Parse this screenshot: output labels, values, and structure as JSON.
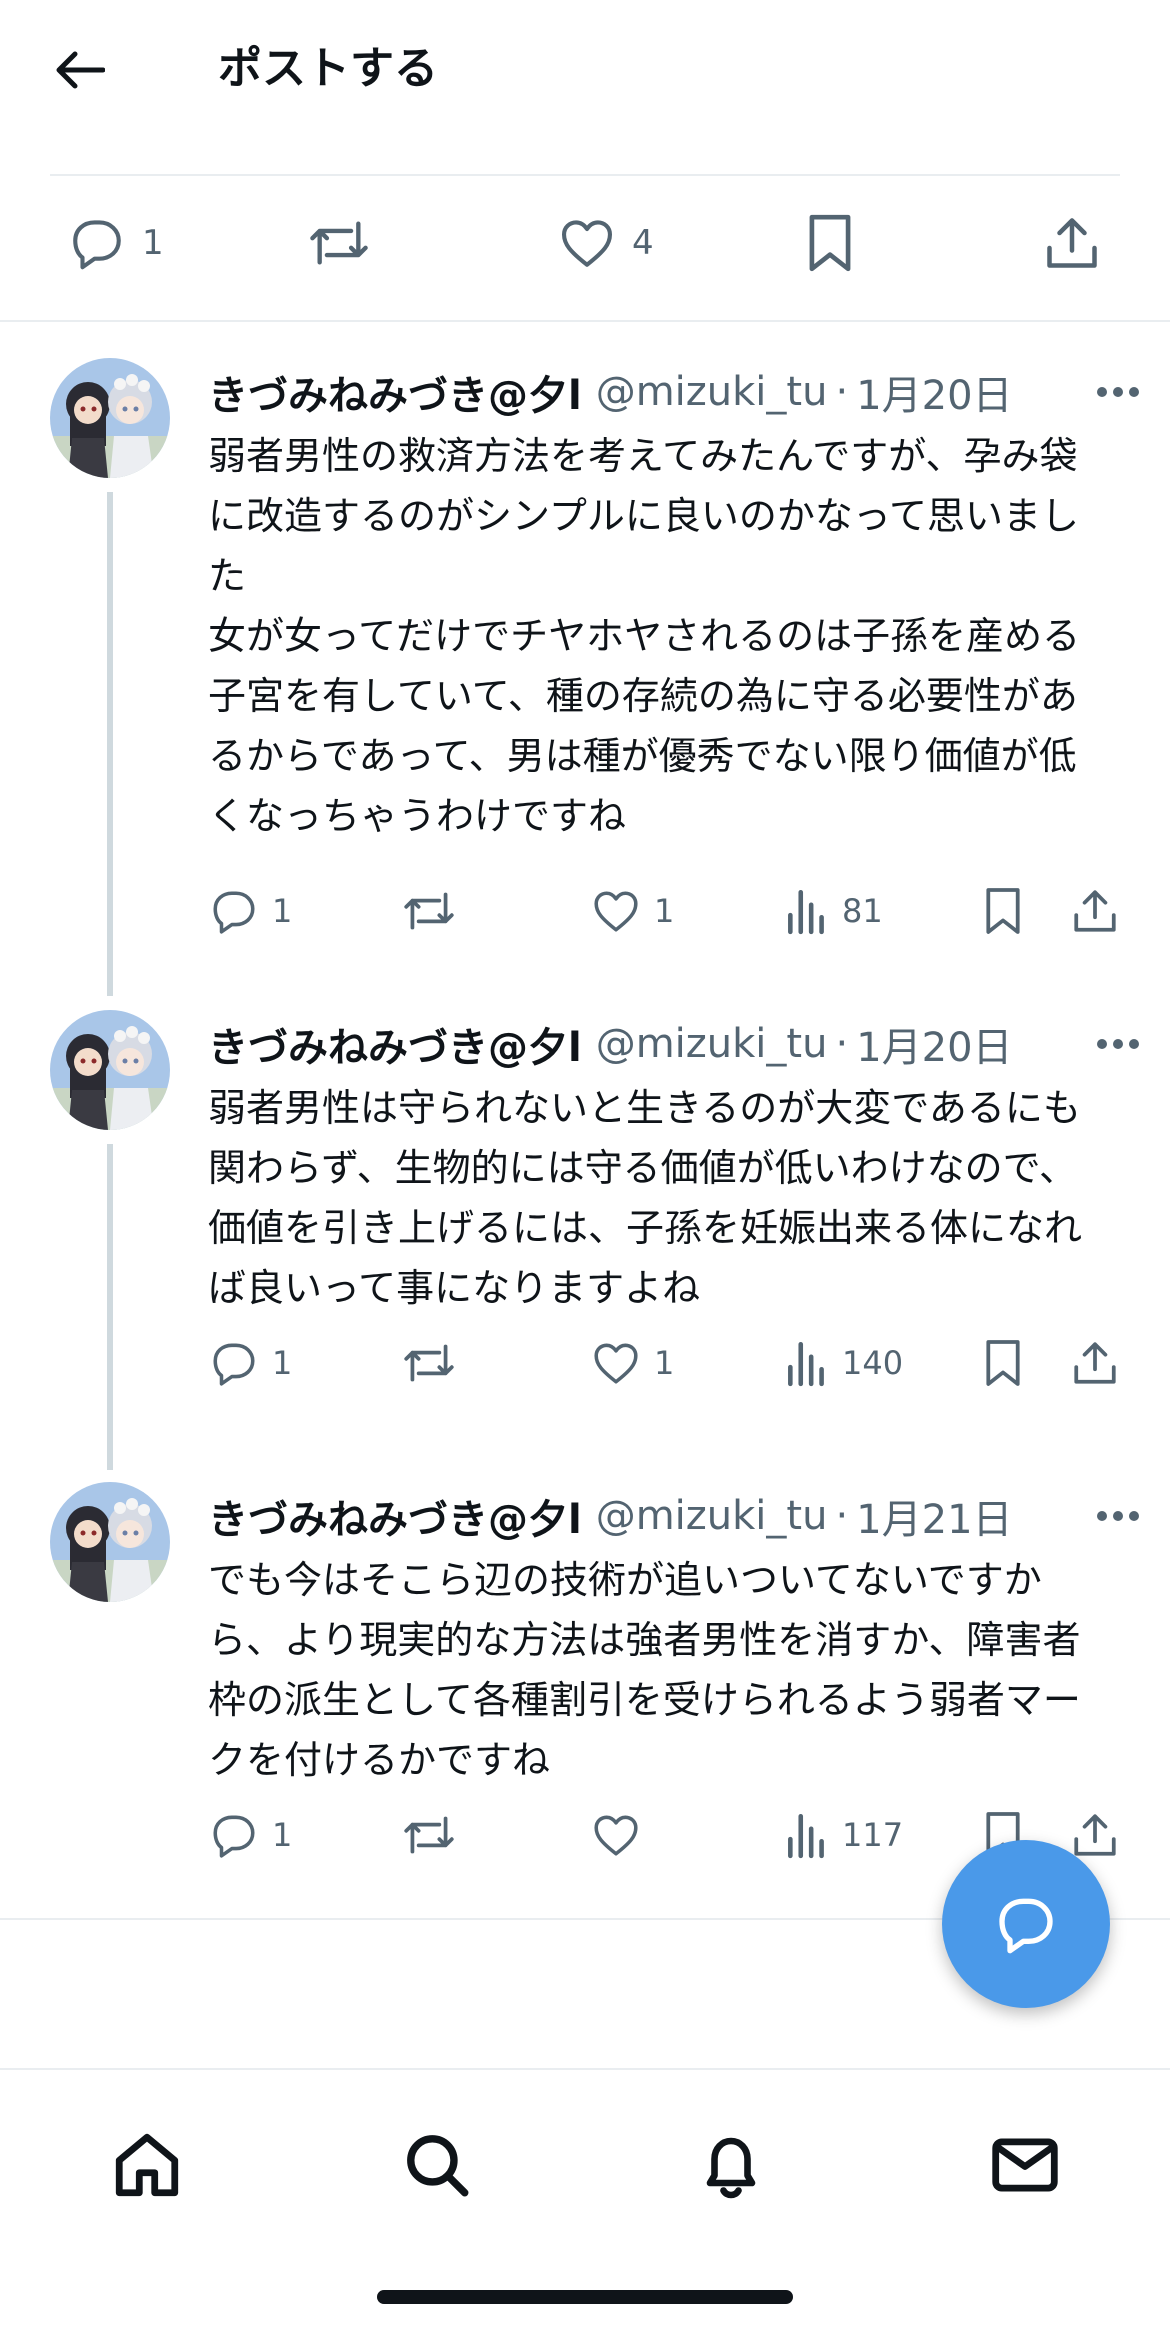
{
  "header": {
    "title": "ポストする",
    "back_icon": "arrow-left-icon"
  },
  "main_post_actions": {
    "replies": "1",
    "likes": "4"
  },
  "replies": [
    {
      "author_name": "きづみねみづき@夕l",
      "handle": "@mizuki_tu",
      "date": "1月20日",
      "text": "弱者男性の救済方法を考えてみたんですが、孕み袋に改造するのがシンプルに良いのかなって思いました\n女が女ってだけでチヤホヤされるのは子孫を産める子宮を有していて、種の存続の為に守る必要性があるからであって、男は種が優秀でない限り価値が低くなっちゃうわけですね",
      "replies": "1",
      "likes": "1",
      "views": "81"
    },
    {
      "author_name": "きづみねみづき@夕l",
      "handle": "@mizuki_tu",
      "date": "1月20日",
      "text": "弱者男性は守られないと生きるのが大変であるにも関わらず、生物的には守る価値が低いわけなので、価値を引き上げるには、子孫を妊娠出来る体になれば良いって事になりますよね",
      "replies": "1",
      "likes": "1",
      "views": "140"
    },
    {
      "author_name": "きづみねみづき@夕l",
      "handle": "@mizuki_tu",
      "date": "1月21日",
      "text": "でも今はそこら辺の技術が追いついてないですから、より現実的な方法は強者男性を消すか、障害者枠の派生として各種割引を受けられるよう弱者マークを付けるかですね",
      "replies": "1",
      "likes": "",
      "views": "117"
    }
  ],
  "dot_separator": "·",
  "colors": {
    "accent": "#4a99e9",
    "text": "#0f1419",
    "muted": "#536471",
    "divider": "#e9edf0",
    "thread_line": "#cfd9de"
  },
  "tab_bar": [
    "home-icon",
    "search-icon",
    "bell-icon",
    "mail-icon"
  ]
}
